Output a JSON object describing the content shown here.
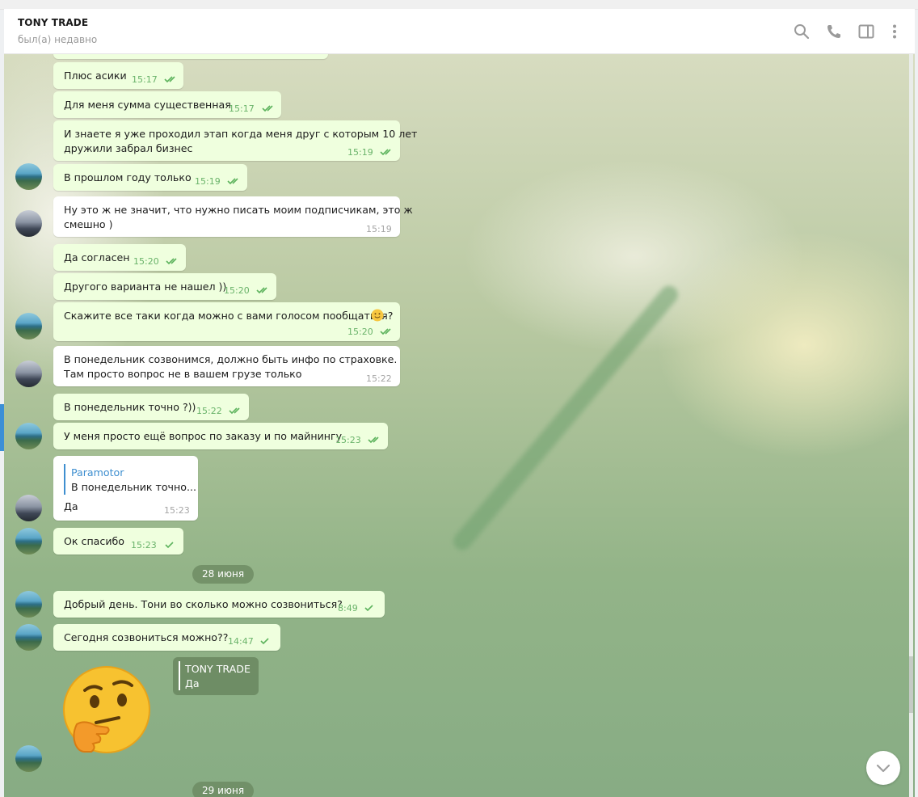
{
  "header": {
    "title": "TONY TRADE",
    "status": "был(а) недавно",
    "icons": [
      "search-icon",
      "phone-icon",
      "sidebar-toggle-icon",
      "more-vertical-icon"
    ]
  },
  "messages": [
    {
      "id": "m1",
      "dir": "out",
      "text": "Плюс асики",
      "time": "15:17",
      "read": true
    },
    {
      "id": "m2",
      "dir": "out",
      "text": "Для меня сумма существенная",
      "time": "15:17",
      "read": true
    },
    {
      "id": "m3",
      "dir": "out",
      "lines": [
        "И знаете я уже проходил этап когда меня друг с которым 10 лет",
        "дружили забрал бизнес"
      ],
      "time": "15:19",
      "read": true
    },
    {
      "id": "m4",
      "dir": "out",
      "text": "В прошлом году только",
      "time": "15:19",
      "read": true
    },
    {
      "id": "m5",
      "dir": "in",
      "lines": [
        "Ну это ж не значит, что нужно писать моим подписчикам, это ж",
        "смешно )"
      ],
      "time": "15:19"
    },
    {
      "id": "m6",
      "dir": "out",
      "text": "Да согласен",
      "time": "15:20",
      "read": true
    },
    {
      "id": "m7",
      "dir": "out",
      "text": "Другого варианта не нашел ))",
      "time": "15:20",
      "read": true
    },
    {
      "id": "m8",
      "dir": "out",
      "text": "Скажите все таки когда можно с вами голосом пообщаться?",
      "emoji": "slightly-smiling-face",
      "time": "15:20",
      "read": true
    },
    {
      "id": "m9",
      "dir": "in",
      "lines": [
        "В понедельник созвонимся, должно быть инфо по страховке.",
        "Там просто вопрос не в вашем грузе только"
      ],
      "time": "15:22"
    },
    {
      "id": "m10",
      "dir": "out",
      "text": "В понедельник точно ?))",
      "time": "15:22",
      "read": true
    },
    {
      "id": "m11",
      "dir": "out",
      "text": "У меня просто ещё вопрос по заказу и по майнингу",
      "time": "15:23",
      "read": true
    },
    {
      "id": "m12",
      "dir": "in",
      "reply_name": "Paramotor",
      "reply_text": "В понедельник точно...",
      "text": "Да",
      "time": "15:23"
    },
    {
      "id": "m13",
      "dir": "out",
      "text": "Ок спасибо",
      "time": "15:23",
      "read": false
    },
    {
      "id": "m14",
      "dir": "out",
      "text": "Добрый день. Тони во сколько можно созвониться?",
      "time": "8:49",
      "read": false
    },
    {
      "id": "m15",
      "dir": "out",
      "text": "Сегодня созвониться можно??",
      "time": "14:47",
      "read": false
    }
  ],
  "dates": [
    "28 июня",
    "29 июня"
  ],
  "forwarded": {
    "name": "TONY TRADE",
    "text": "Да"
  },
  "sticker": "thinking-face",
  "colors": {
    "accent": "#3f8fd0",
    "tick": "#5db35d",
    "outgoing": "#efffde",
    "incoming": "#ffffff"
  }
}
